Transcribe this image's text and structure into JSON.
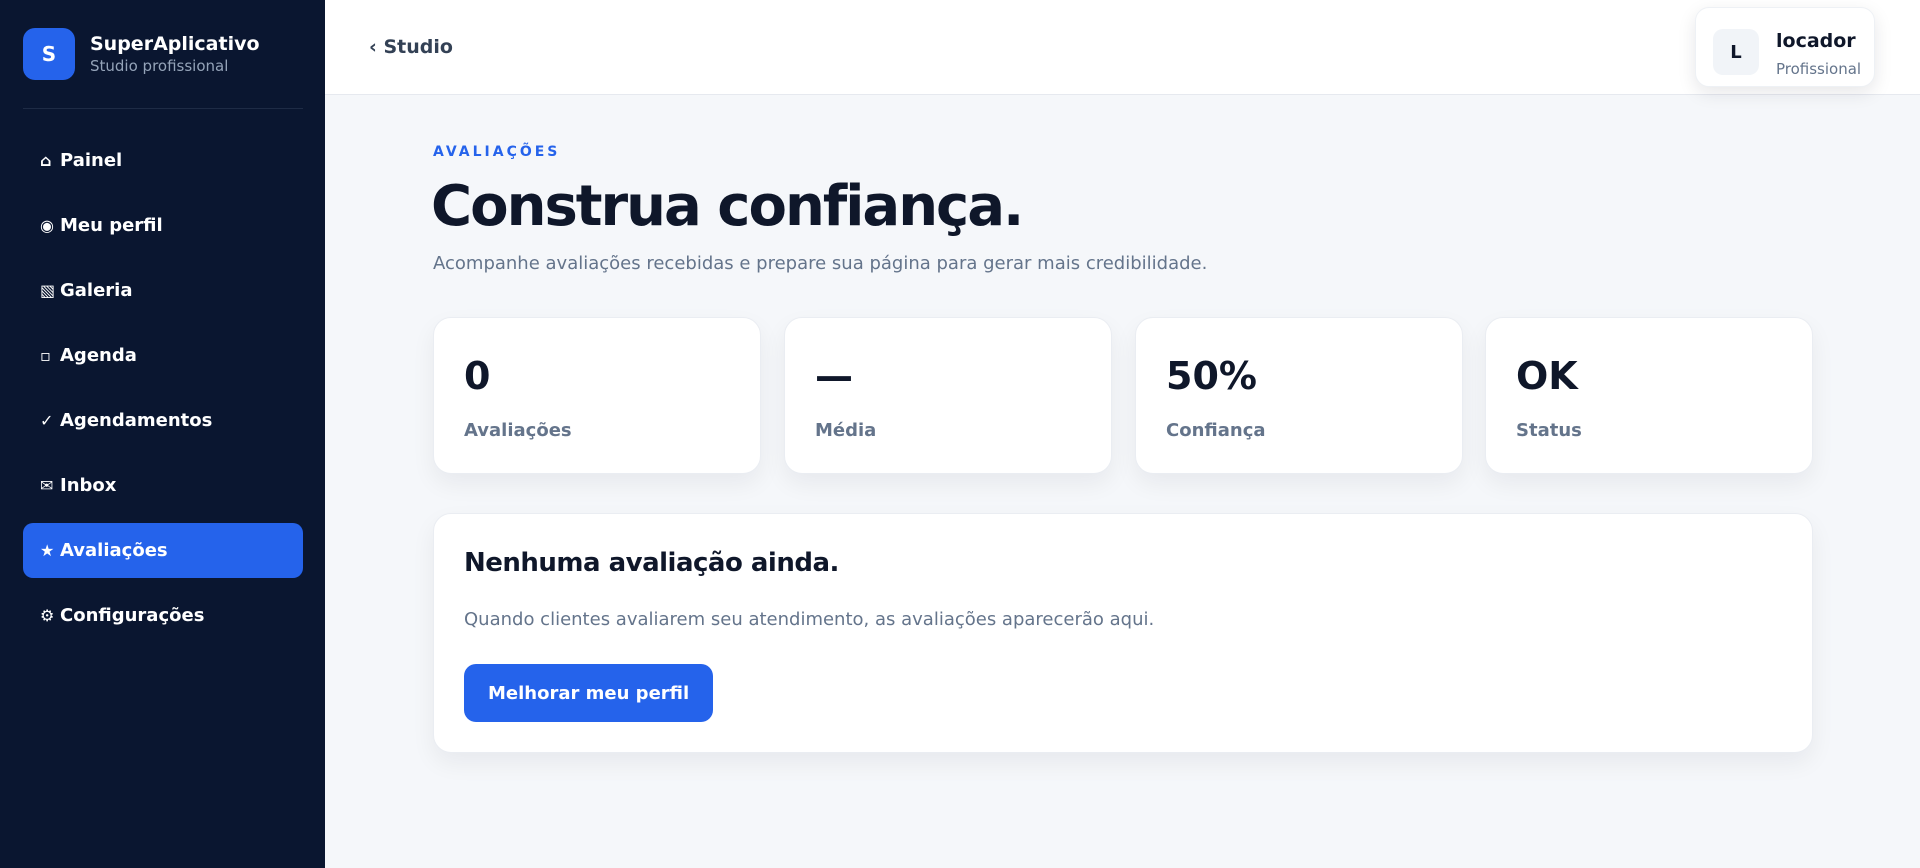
{
  "brand": {
    "logo_letter": "S",
    "name": "SuperAplicativo",
    "subtitle": "Studio profissional",
    "accent": "#2563eb"
  },
  "sidebar": {
    "background": "#0a1630",
    "items": [
      {
        "icon": "⌂",
        "icon_name": "home-icon",
        "label": "Painel"
      },
      {
        "icon": "◉",
        "icon_name": "profile-icon",
        "label": "Meu perfil"
      },
      {
        "icon": "▧",
        "icon_name": "gallery-icon",
        "label": "Galeria"
      },
      {
        "icon": "▫",
        "icon_name": "calendar-icon",
        "label": "Agenda"
      },
      {
        "icon": "✓",
        "icon_name": "check-icon",
        "label": "Agendamentos"
      },
      {
        "icon": "✉",
        "icon_name": "mail-icon",
        "label": "Inbox"
      },
      {
        "icon": "★",
        "icon_name": "star-icon",
        "label": "Avaliações",
        "active": true
      },
      {
        "icon": "⚙",
        "icon_name": "gear-icon",
        "label": "Configurações"
      }
    ]
  },
  "header": {
    "back_label": "‹ Studio",
    "user": {
      "avatar_letter": "L",
      "name": "locador",
      "role": "Profissional"
    }
  },
  "main": {
    "eyebrow": "AVALIAÇÕES",
    "title": "Construa confiança.",
    "subtitle": "Acompanhe avaliações recebidas e prepare sua página para gerar mais credibilidade.",
    "stats": [
      {
        "value": "0",
        "label": "Avaliações"
      },
      {
        "value": "—",
        "label": "Média"
      },
      {
        "value": "50%",
        "label": "Confiança"
      },
      {
        "value": "OK",
        "label": "Status"
      }
    ],
    "empty": {
      "title": "Nenhuma avaliação ainda.",
      "text": "Quando clientes avaliarem seu atendimento, as avaliações aparecerão aqui.",
      "button": "Melhorar meu perfil"
    }
  }
}
